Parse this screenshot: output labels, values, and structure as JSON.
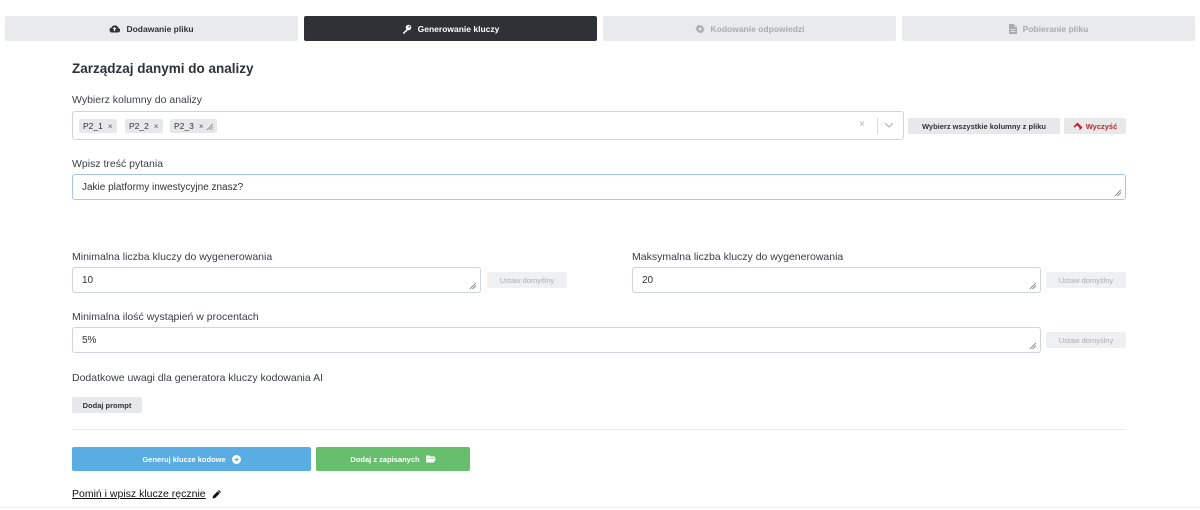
{
  "steps": [
    {
      "label": "Dodawanie pliku",
      "icon": "cloud-upload-icon",
      "state": "done"
    },
    {
      "label": "Generowanie kluczy",
      "icon": "key-icon",
      "state": "active"
    },
    {
      "label": "Kodowanie odpowiedzi",
      "icon": "gear-icon",
      "state": "disabled"
    },
    {
      "label": "Pobieranie pliku",
      "icon": "file-icon",
      "state": "disabled"
    }
  ],
  "title": "Zarządzaj danymi do analizy",
  "columns": {
    "label": "Wybierz kolumny do analizy",
    "tags": [
      {
        "label": "P2_1",
        "remove": "×"
      },
      {
        "label": "P2_2",
        "remove": "×"
      },
      {
        "label": "P2_3",
        "remove": "×"
      }
    ],
    "clear_glyph": "×",
    "select_all_label": "Wybierz wszystkie kolumny z pliku",
    "clear_label": "Wyczyść"
  },
  "question": {
    "label": "Wpisz treść pytania",
    "value": "Jakie platformy inwestycyjne znasz?"
  },
  "min_keys": {
    "label": "Minimalna liczba kluczy do wygenerowania",
    "value": "10",
    "default_label": "Ustaw domyślny"
  },
  "max_keys": {
    "label": "Maksymalna liczba kluczy do wygenerowania",
    "value": "20",
    "default_label": "Ustaw domyślny"
  },
  "min_occurrence": {
    "label": "Minimalna ilość wystąpień w procentach",
    "value": "5%",
    "default_label": "Ustaw domyślny"
  },
  "remarks": {
    "label": "Dodatkowe uwagi dla generatora kluczy kodowania AI",
    "add_prompt_label": "Dodaj prompt"
  },
  "actions": {
    "generate_label": "Generuj klucze kodowe",
    "add_saved_label": "Dodaj z zapisanych",
    "skip_label": "Pomiń i wpisz klucze ręcznie"
  },
  "colors": {
    "active_step": "#2e3236",
    "primary": "#5aade3",
    "success": "#67bf6e",
    "danger": "#c0262b"
  }
}
